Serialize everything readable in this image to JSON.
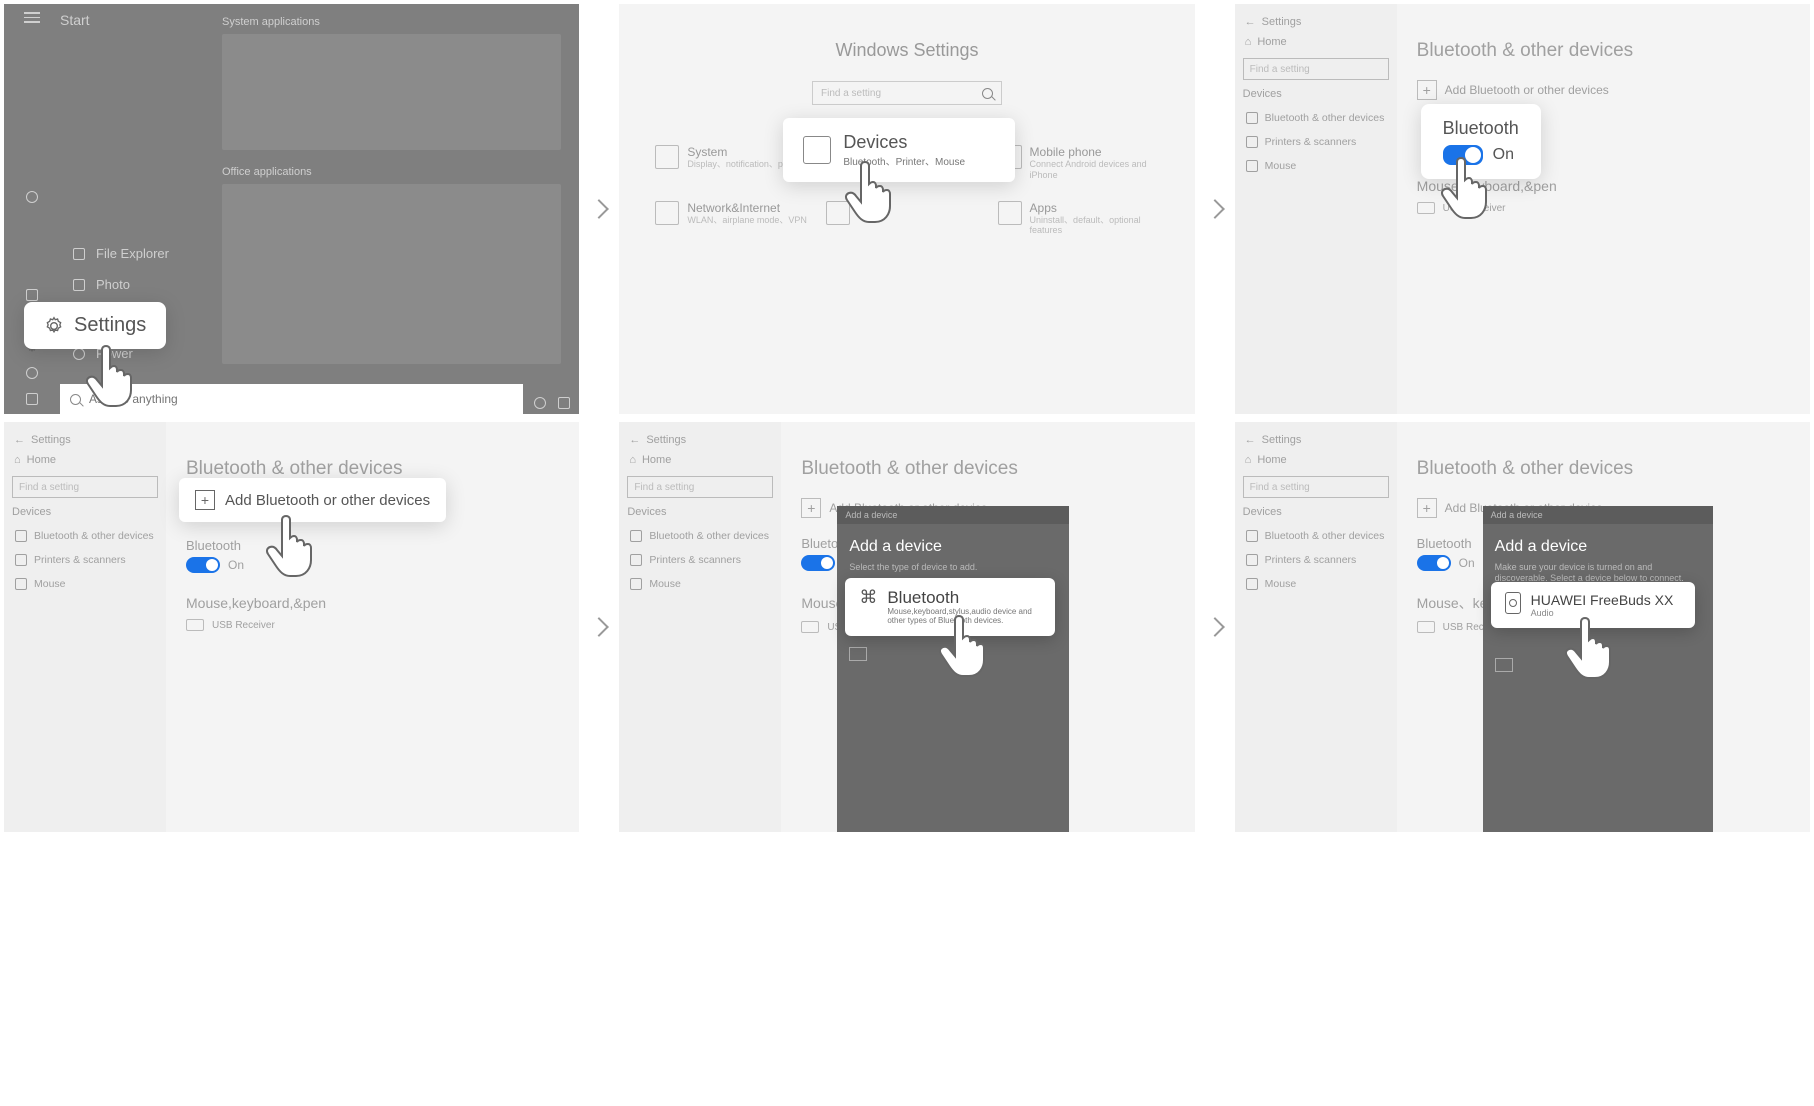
{
  "panel1": {
    "start": "Start",
    "tiles": {
      "sys": "System applications",
      "office": "Office applications"
    },
    "menu": {
      "file_explorer": "File Explorer",
      "photo": "Photo",
      "power": "Power"
    },
    "search_placeholder": "Ask me anything",
    "settings_popup": "Settings"
  },
  "panel2": {
    "title": "Windows Settings",
    "search_placeholder": "Find a setting",
    "categories": {
      "system": {
        "title": "System",
        "sub": "Display、notification、power"
      },
      "mobile": {
        "title": "Mobile phone",
        "sub": "Connect Android devices and iPhone"
      },
      "network": {
        "title": "Network&Internet",
        "sub": "WLAN、airplane mode、VPN"
      },
      "apps": {
        "title": "Apps",
        "sub": "Uninstall、default、optional features"
      }
    },
    "devices_popup": {
      "title": "Devices",
      "sub": "Bluetooth、Printer、Mouse"
    }
  },
  "settings_side": {
    "back": "Settings",
    "home": "Home",
    "search_placeholder": "Find a setting",
    "section": "Devices",
    "items": {
      "bt": "Bluetooth & other devices",
      "printers": "Printers & scanners",
      "mouse": "Mouse"
    }
  },
  "bt_page": {
    "title": "Bluetooth & other devices",
    "add": "Add Bluetooth or other devices",
    "add_singular": "Add Bluetooth or other device",
    "bt_label": "Bluetooth",
    "on": "On",
    "section": "Mouse,keyboard,&pen",
    "receiver": "USB Receiver"
  },
  "panel3_popup": {
    "title": "Bluetooth",
    "on": "On"
  },
  "panel4_popup": {
    "text": "Add Bluetooth or other devices"
  },
  "dialog": {
    "top": "Add a device",
    "title": "Add a device",
    "sub5": "Select the type of device to add.",
    "sub6": "Make sure your device is turned on and discoverable. Select a device below to connect."
  },
  "bt_option5": {
    "title": "Bluetooth",
    "sub": "Mouse,keyboard,stylus,audio device and other types of Bluetooth devices."
  },
  "bt_option6": {
    "title": "HUAWEI FreeBuds XX",
    "sub": "Audio"
  }
}
